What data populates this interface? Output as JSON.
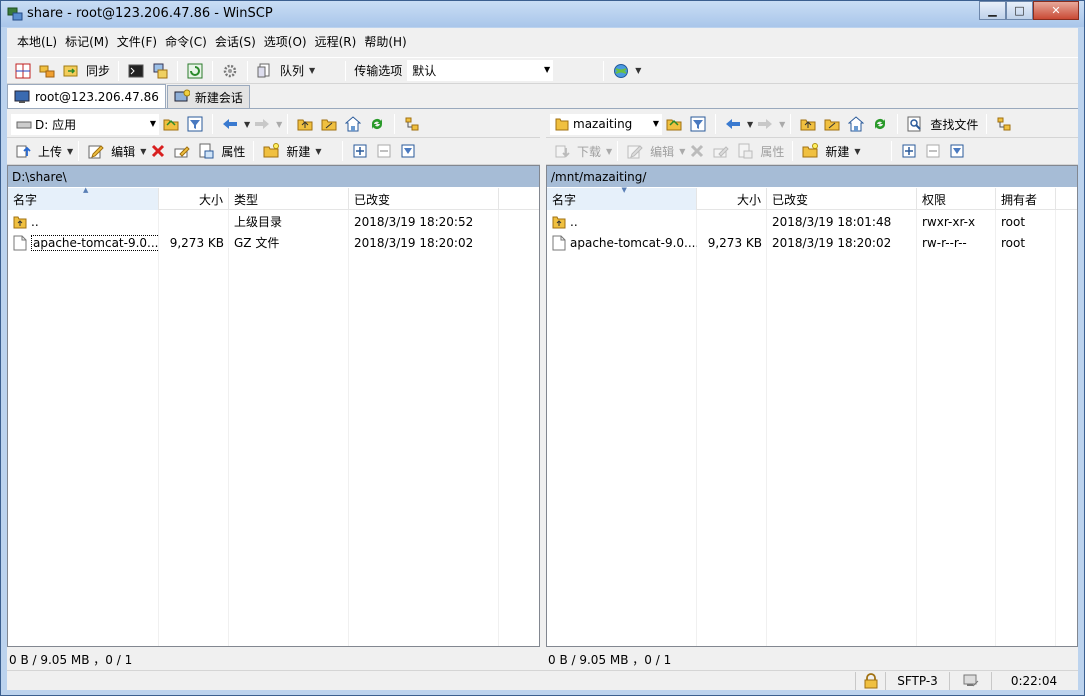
{
  "window": {
    "title": "share - root@123.206.47.86 - WinSCP",
    "min_label": "▁",
    "max_label": "□",
    "close_label": "✕"
  },
  "menu": [
    "本地(L)",
    "标记(M)",
    "文件(F)",
    "命令(C)",
    "会话(S)",
    "选项(O)",
    "远程(R)",
    "帮助(H)"
  ],
  "toolbar_main": {
    "sync_label": "同步",
    "queue_label": "队列",
    "transfer_options_label": "传输选项",
    "transfer_preset": "默认"
  },
  "tabs": [
    {
      "label": "root@123.206.47.86",
      "active": true
    },
    {
      "label": "新建会话",
      "active": false
    }
  ],
  "left": {
    "drive": "D: 应用",
    "upload_label": "上传",
    "edit_label": "编辑",
    "properties_label": "属性",
    "new_label": "新建",
    "path": "D:\\share\\",
    "columns": [
      "名字",
      "大小",
      "类型",
      "已改变"
    ],
    "rows": [
      {
        "name": "..",
        "size": "",
        "type": "上级目录",
        "changed": "2018/3/19   18:20:52",
        "kind": "parent"
      },
      {
        "name": "apache-tomcat-9.0....",
        "size": "9,273 KB",
        "type": "GZ 文件",
        "changed": "2018/3/19   18:20:02",
        "kind": "file"
      }
    ],
    "status": "0 B / 9.05 MB ，0 / 1"
  },
  "right": {
    "directory": "mazaiting",
    "find_label": "查找文件",
    "download_label": "下载",
    "edit_label": "编辑",
    "properties_label": "属性",
    "new_label": "新建",
    "path": "/mnt/mazaiting/",
    "columns": [
      "名字",
      "大小",
      "已改变",
      "权限",
      "拥有者"
    ],
    "rows": [
      {
        "name": "..",
        "size": "",
        "changed": "2018/3/19   18:01:48",
        "rights": "rwxr-xr-x",
        "owner": "root",
        "kind": "parent"
      },
      {
        "name": "apache-tomcat-9.0....",
        "size": "9,273 KB",
        "changed": "2018/3/19   18:20:02",
        "rights": "rw-r--r--",
        "owner": "root",
        "kind": "file"
      }
    ],
    "status": "0 B / 9.05 MB ，0 / 1"
  },
  "statusbar": {
    "protocol": "SFTP-3",
    "elapsed": "0:22:04"
  },
  "colors": {
    "path_bar": "#a6bcd6",
    "title_gradient_top": "#c9ddf4",
    "delete_red": "#d92020"
  }
}
